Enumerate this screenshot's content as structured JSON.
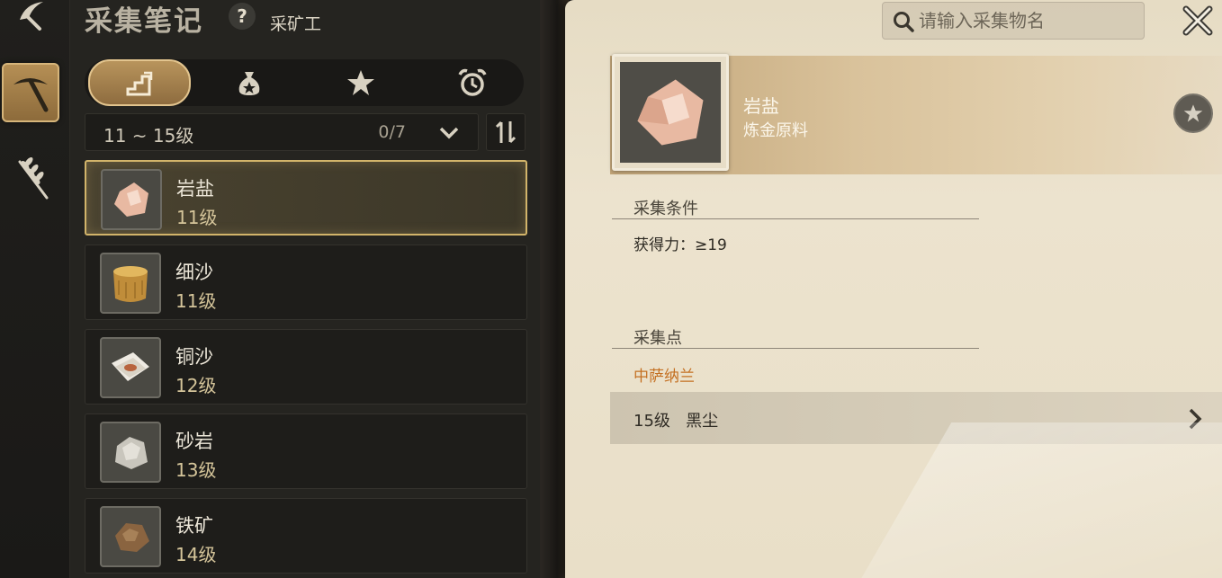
{
  "panel": {
    "title": "采集笔记",
    "help_label": "?",
    "job_label": "采矿工"
  },
  "rail": {
    "items": [
      "sickle-icon",
      "pickaxe-icon",
      "wheat-icon"
    ],
    "active": "pickaxe-icon"
  },
  "tabs": {
    "items": [
      "level-stairs-icon",
      "money-bag-icon",
      "star-icon",
      "alarm-clock-icon"
    ],
    "active": "level-stairs-icon"
  },
  "filter": {
    "range": "11 ~ 15级",
    "count": "0/7"
  },
  "list": [
    {
      "name": "岩盐",
      "level": "11级",
      "icon": "rock-salt-icon",
      "selected": true
    },
    {
      "name": "细沙",
      "level": "11级",
      "icon": "sand-sack-icon",
      "selected": false
    },
    {
      "name": "铜沙",
      "level": "12级",
      "icon": "copper-sand-icon",
      "selected": false
    },
    {
      "name": "砂岩",
      "level": "13级",
      "icon": "sandstone-icon",
      "selected": false
    },
    {
      "name": "铁矿",
      "level": "14级",
      "icon": "iron-ore-icon",
      "selected": false
    }
  ],
  "search": {
    "placeholder": "请输入采集物名"
  },
  "detail": {
    "name": "岩盐",
    "type": "炼金原料",
    "conditions_heading": "采集条件",
    "condition": "获得力：≥19",
    "points_heading": "采集点",
    "region": "中萨纳兰",
    "point_entry": "15级   黑尘"
  },
  "colors": {
    "accent_gold": "#d2b46a",
    "region_orange": "#c47022",
    "parchment": "#ece3ce",
    "panel_dark": "#252420"
  }
}
